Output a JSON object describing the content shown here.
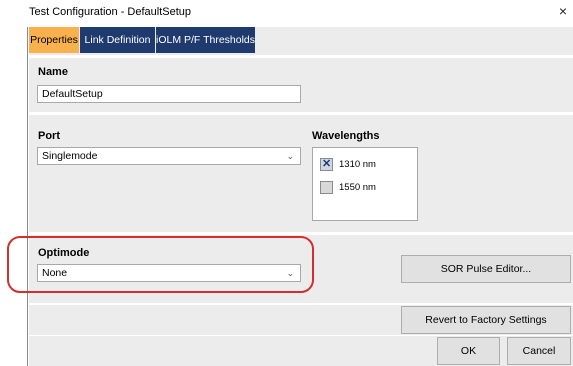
{
  "window": {
    "title": "Test Configuration - DefaultSetup",
    "close_glyph": "×"
  },
  "tabs": [
    {
      "label": "Properties",
      "active": true
    },
    {
      "label": "Link Definition",
      "active": false
    },
    {
      "label": "iOLM P/F Thresholds",
      "active": false
    }
  ],
  "name": {
    "label": "Name",
    "value": "DefaultSetup"
  },
  "port": {
    "label": "Port",
    "value": "Singlemode"
  },
  "wavelengths": {
    "label": "Wavelengths",
    "items": [
      {
        "label": "1310 nm",
        "checked": true
      },
      {
        "label": "1550 nm",
        "checked": false
      }
    ]
  },
  "optimode": {
    "label": "Optimode",
    "value": "None"
  },
  "buttons": {
    "sor_pulse_editor": "SOR Pulse Editor...",
    "revert": "Revert to Factory Settings",
    "ok": "OK",
    "cancel": "Cancel"
  },
  "colors": {
    "tab_active": "#f8b14c",
    "tab_inactive": "#1e3a6e",
    "highlight": "#d32f2f"
  },
  "icons": {
    "close": "close-icon",
    "dropdown": "chevron-down-icon",
    "check": "checkbox-check-icon"
  }
}
